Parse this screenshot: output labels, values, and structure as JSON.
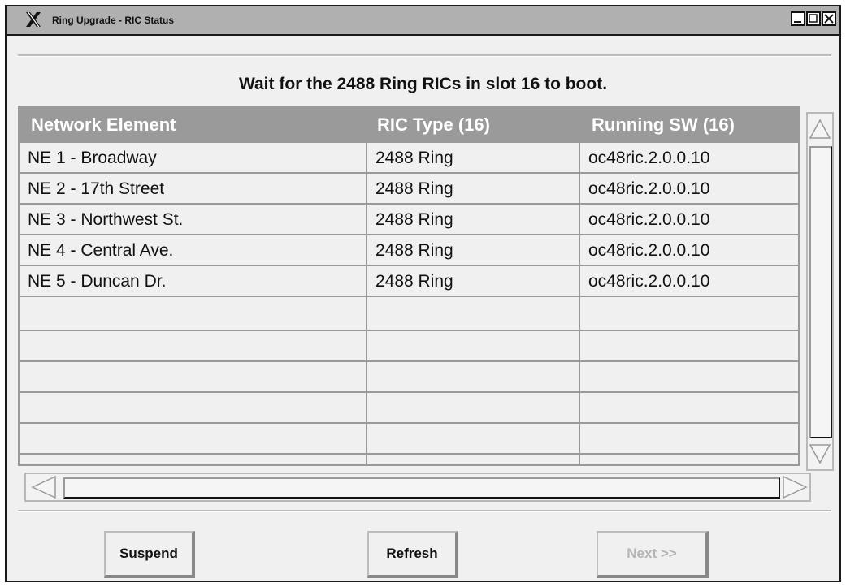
{
  "window": {
    "title": "Ring Upgrade - RIC Status",
    "controls": [
      "minimize-icon",
      "maximize-icon",
      "close-icon"
    ]
  },
  "heading": "Wait for the 2488 Ring RICs in slot 16 to boot.",
  "table": {
    "columns": [
      "Network Element",
      "RIC Type (16)",
      "Running SW (16)"
    ],
    "rows": [
      [
        "NE 1 - Broadway",
        "2488 Ring",
        "oc48ric.2.0.0.10"
      ],
      [
        "NE 2 - 17th Street",
        "2488 Ring",
        "oc48ric.2.0.0.10"
      ],
      [
        "NE 3 - Northwest St.",
        "2488 Ring",
        "oc48ric.2.0.0.10"
      ],
      [
        "NE 4 - Central Ave.",
        "2488 Ring",
        "oc48ric.2.0.0.10"
      ],
      [
        "NE 5 - Duncan Dr.",
        "2488 Ring",
        "oc48ric.2.0.0.10"
      ]
    ]
  },
  "buttons": {
    "suspend": "Suspend",
    "refresh": "Refresh",
    "next": "Next >>"
  },
  "colors": {
    "header_bg": "#9a9a9a",
    "window_bg": "#f0f0f0",
    "disabled_text": "#b5b5b5"
  }
}
